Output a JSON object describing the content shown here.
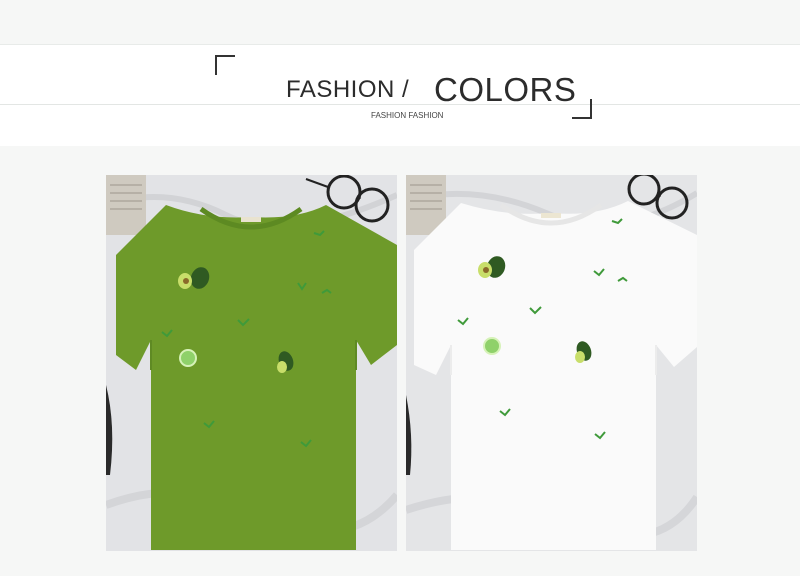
{
  "header": {
    "title_part1": "FASHION /",
    "title_part2": "COLORS",
    "subtitle": "FASHION FASHION"
  },
  "products": [
    {
      "shirt_color": "#6e9a2a",
      "description": "green t-shirt with avocado and lime embroidery"
    },
    {
      "shirt_color": "#fafafa",
      "description": "white t-shirt with avocado and lime embroidery"
    }
  ],
  "colors": {
    "background": "#f6f7f6",
    "banner": "#ffffff",
    "text": "#2c2c2c",
    "leaf": "#3f9a3a",
    "avocado_dark": "#2f5a22",
    "avocado_flesh": "#c8de6a",
    "lime": "#8fd16a"
  }
}
